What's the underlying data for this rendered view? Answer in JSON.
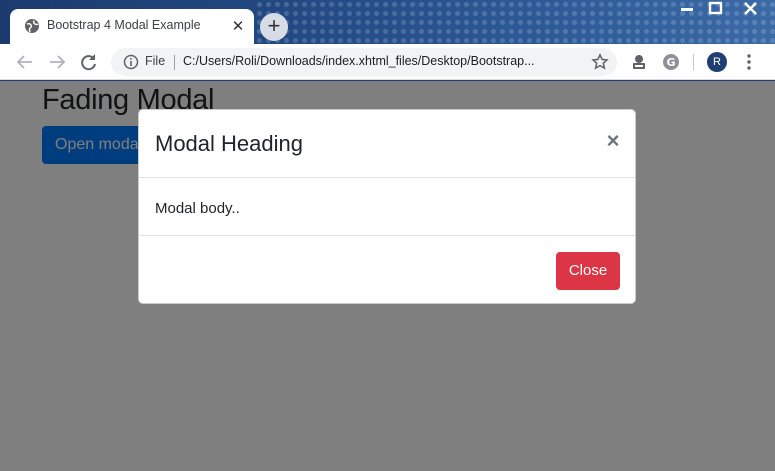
{
  "browser": {
    "tab": {
      "title": "Bootstrap 4 Modal Example",
      "favicon": "globe-icon",
      "close_icon": "close-icon"
    },
    "new_tab_icon": "plus-icon",
    "window_controls": [
      "minimize-icon",
      "maximize-icon",
      "close-icon"
    ],
    "toolbar": {
      "back_icon": "arrow-left-icon",
      "forward_icon": "arrow-right-icon",
      "reload_icon": "reload-icon",
      "site_info_icon": "info-icon",
      "scheme_label": "File",
      "url": "C:/Users/Roli/Downloads/index.xhtml_files/Desktop/Bootstrap...",
      "bookmark_icon": "star-icon",
      "extensions": [
        "extension-icon",
        "grammarly-icon"
      ],
      "avatar_initial": "R",
      "menu_icon": "kebab-menu-icon"
    }
  },
  "page": {
    "heading": "Fading Modal",
    "open_button_label": "Open modal"
  },
  "modal": {
    "title": "Modal Heading",
    "close_glyph": "×",
    "body": "Modal body..",
    "footer_button_label": "Close"
  },
  "colors": {
    "primary": "#007bff",
    "danger": "#dc3545",
    "backdrop": "rgba(0,0,0,0.5)",
    "titlebar": "#1b3b6f"
  }
}
